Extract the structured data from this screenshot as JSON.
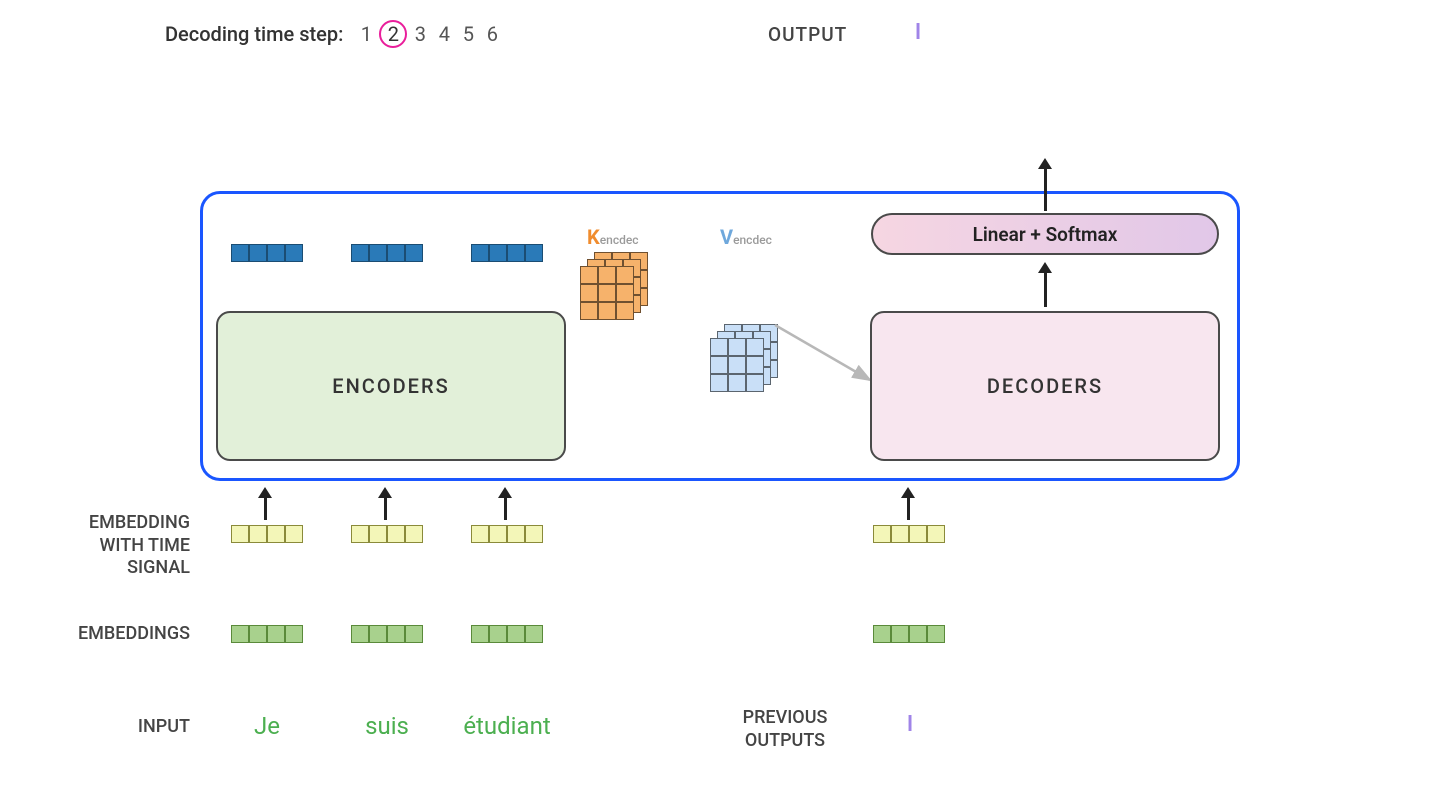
{
  "header": {
    "decoding_label": "Decoding time step:",
    "steps": [
      "1",
      "2",
      "3",
      "4",
      "5",
      "6"
    ],
    "current_step_index": 1,
    "output_label": "OUTPUT",
    "output_token": "I"
  },
  "kv": {
    "k_letter": "K",
    "k_sub": "encdec",
    "v_letter": "V",
    "v_sub": "encdec"
  },
  "boxes": {
    "encoders": "ENCODERS",
    "decoders": "DECODERS",
    "linear_softmax": "Linear + Softmax"
  },
  "side_labels": {
    "emb_time_1": "EMBEDDING",
    "emb_time_2": "WITH TIME",
    "emb_time_3": "SIGNAL",
    "embeddings": "EMBEDDINGS",
    "input": "INPUT",
    "previous_outputs_1": "PREVIOUS",
    "previous_outputs_2": "OUTPUTS",
    "prev_token": "I"
  },
  "input_words": [
    "Je",
    "suis",
    "étudiant"
  ],
  "colors": {
    "accent_blue": "#1a56ff",
    "encoder_bg": "#e2f0d9",
    "decoder_bg": "#f8e6ef",
    "highlight_pink": "#e91e9b",
    "k_orange": "#f08c2e",
    "v_blue": "#6fa8dc",
    "token_purple": "#a084e8",
    "word_green": "#4caf50"
  }
}
